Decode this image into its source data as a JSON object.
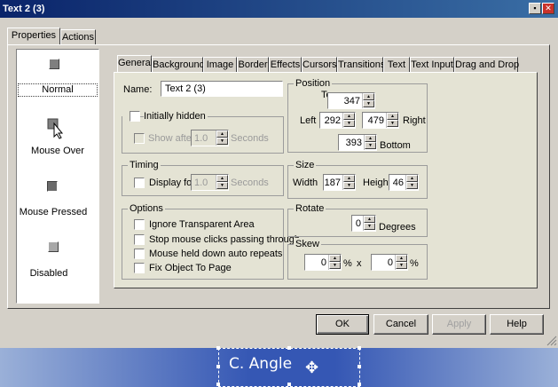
{
  "window": {
    "title": "Text 2 (3)",
    "minimize_glyph": "▪",
    "close_glyph": "✕"
  },
  "outer_tabs": [
    "Properties",
    "Actions"
  ],
  "states": [
    "Normal",
    "Mouse Over",
    "Mouse Pressed",
    "Disabled"
  ],
  "state_icons": [
    "button-swatch-icon",
    "cursor-pointer-icon",
    "button-swatch-icon",
    "button-swatch-icon"
  ],
  "inner_tabs": [
    "General",
    "Background",
    "Image",
    "Border",
    "Effects",
    "Cursors",
    "Transitions",
    "Text",
    "Text Input",
    "Drag and Drop"
  ],
  "general": {
    "name_label": "Name:",
    "name_value": "Text 2 (3)",
    "initially_hidden": "Initially hidden",
    "show_after": "Show after",
    "show_after_value": "1.0",
    "show_after_unit": "Seconds",
    "timing_title": "Timing",
    "display_for": "Display for",
    "display_for_value": "1.0",
    "display_for_unit": "Seconds",
    "options_title": "Options",
    "options": [
      "Ignore Transparent Area",
      "Stop mouse clicks passing through",
      "Mouse held down auto repeats",
      "Fix Object To Page"
    ]
  },
  "position": {
    "title": "Position",
    "top_label": "Top",
    "top": "347",
    "left_label": "Left",
    "left": "292",
    "right_value": "479",
    "right_label": "Right",
    "bottom": "393",
    "bottom_label": "Bottom"
  },
  "size": {
    "title": "Size",
    "width_label": "Width",
    "width": "187",
    "height_label": "Height",
    "height": "46"
  },
  "rotate": {
    "title": "Rotate",
    "value": "0",
    "unit": "Degrees"
  },
  "skew": {
    "title": "Skew",
    "x_value": "0",
    "x_unit": "%",
    "sep": "x",
    "y_value": "0",
    "y_unit": "%"
  },
  "buttons": {
    "ok": "OK",
    "cancel": "Cancel",
    "apply": "Apply",
    "help": "Help"
  },
  "canvas": {
    "object_text": "C. Angle",
    "move_glyph": "✥"
  }
}
